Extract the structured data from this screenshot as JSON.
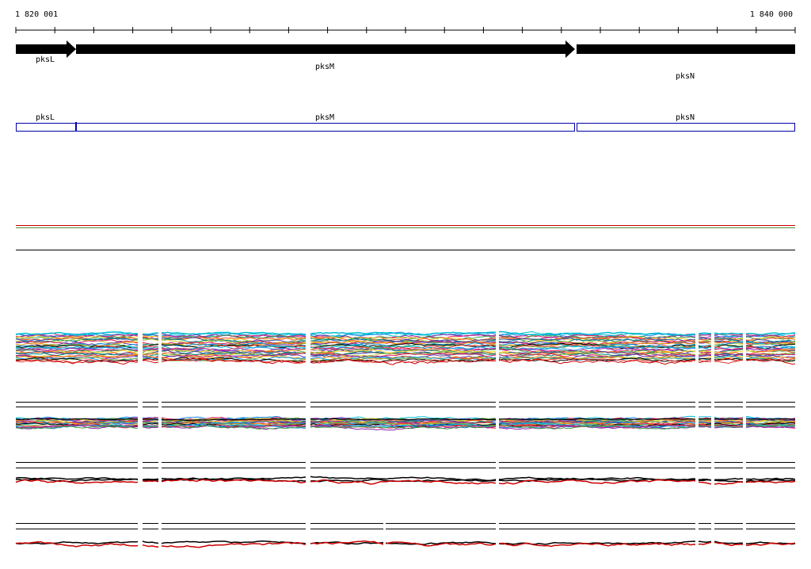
{
  "ruler": {
    "start_label": "1 820 001",
    "end_label": "1 840 000"
  },
  "genes": [
    {
      "name": "pksL",
      "strand": "+"
    },
    {
      "name": "pksM",
      "strand": "+"
    },
    {
      "name": "pksN",
      "strand": "+"
    }
  ],
  "annotation_track": [
    {
      "name": "pksL"
    },
    {
      "name": "pksM"
    },
    {
      "name": "pksN"
    }
  ],
  "colors": {
    "gene_fill": "#000000",
    "annotation_box": "#0000aa",
    "line_red": "#cc0000",
    "line_green": "#5a8a3a",
    "line_black": "#000000"
  },
  "tracks": [
    {
      "kind": "multi-color-traces"
    },
    {
      "kind": "multi-color-traces"
    },
    {
      "kind": "black-red-traces"
    },
    {
      "kind": "black-red-traces"
    }
  ]
}
